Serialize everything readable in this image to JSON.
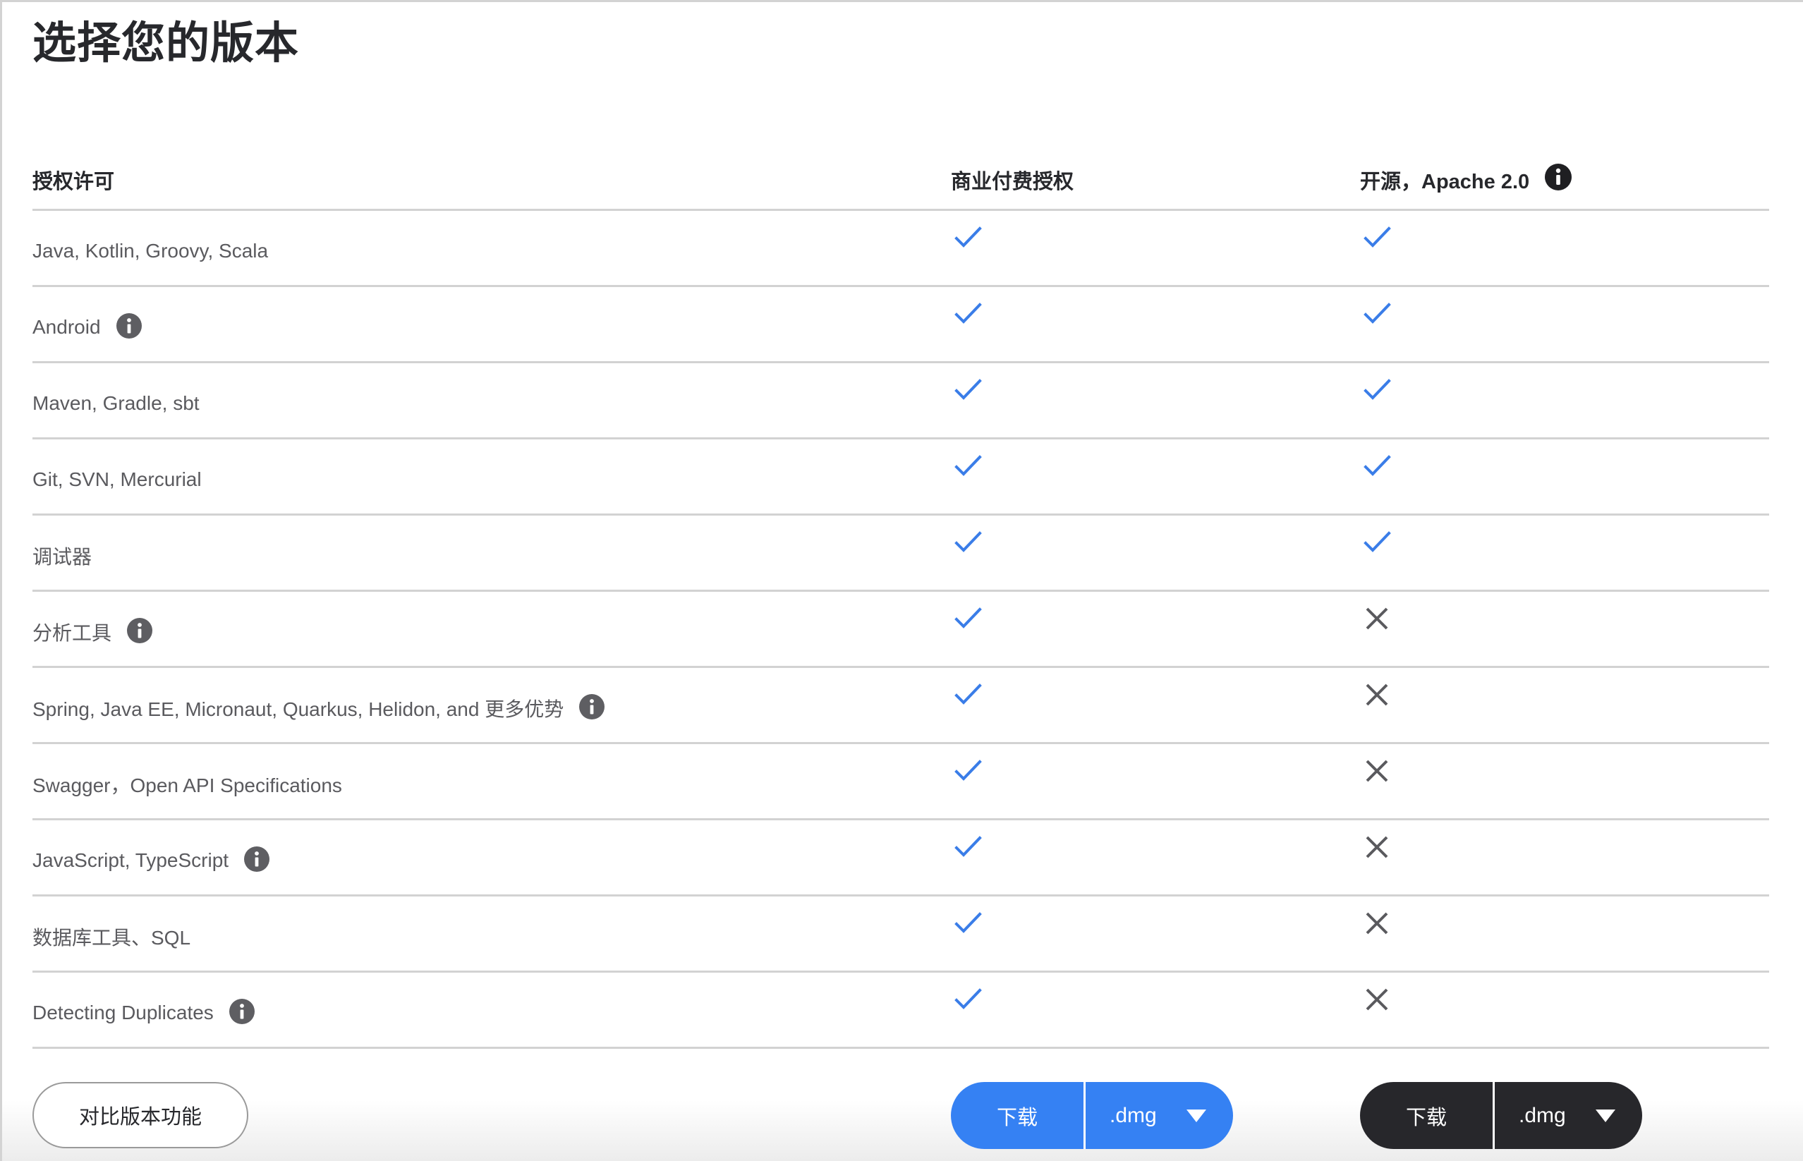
{
  "page": {
    "title": "选择您的版本"
  },
  "table": {
    "headers": {
      "license": "授权许可",
      "commercial": "商业付费授权",
      "open_source": "开源，Apache 2.0",
      "open_source_info_icon": "info-icon"
    },
    "rows": [
      {
        "feature": "Java, Kotlin, Groovy, Scala",
        "info": false,
        "commercial": "check",
        "open_source": "check"
      },
      {
        "feature": "Android",
        "info": true,
        "commercial": "check",
        "open_source": "check"
      },
      {
        "feature": "Maven, Gradle, sbt",
        "info": false,
        "commercial": "check",
        "open_source": "check"
      },
      {
        "feature": "Git, SVN, Mercurial",
        "info": false,
        "commercial": "check",
        "open_source": "check"
      },
      {
        "feature": "调试器",
        "info": false,
        "commercial": "check",
        "open_source": "check"
      },
      {
        "feature": "分析工具",
        "info": true,
        "commercial": "check",
        "open_source": "cross"
      },
      {
        "feature": "Spring, Java EE, Micronaut, Quarkus, Helidon, and 更多优势",
        "info": true,
        "commercial": "check",
        "open_source": "cross"
      },
      {
        "feature": "Swagger，Open API Specifications",
        "info": false,
        "commercial": "check",
        "open_source": "cross"
      },
      {
        "feature": "JavaScript, TypeScript",
        "info": true,
        "commercial": "check",
        "open_source": "cross"
      },
      {
        "feature": "数据库工具、SQL",
        "info": false,
        "commercial": "check",
        "open_source": "cross"
      },
      {
        "feature": "Detecting Duplicates",
        "info": true,
        "commercial": "check",
        "open_source": "cross"
      }
    ]
  },
  "actions": {
    "compare_label": "对比版本功能",
    "commercial_download": {
      "label": "下载",
      "format": ".dmg",
      "dropdown_icon": "caret-down-icon"
    },
    "open_source_download": {
      "label": "下载",
      "format": ".dmg",
      "dropdown_icon": "caret-down-icon"
    }
  },
  "colors": {
    "accent_blue": "#3581f3",
    "dark_button": "#27272b",
    "check": "#3a7de8",
    "cross": "#5a5a5e",
    "info_icon": "#5e5e62",
    "divider": "#d2d2d2"
  }
}
